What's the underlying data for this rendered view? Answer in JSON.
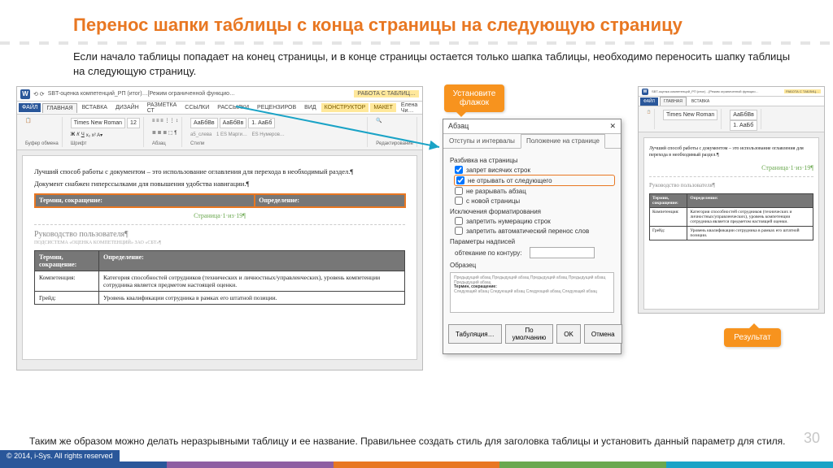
{
  "title": "Перенос шапки таблицы с конца страницы на следующую страницу",
  "intro": "Если начало таблицы попадает на конец страницы, и в конце страницы остается только шапка таблицы, необходимо переносить шапку таблицы на следующую страницу.",
  "word_left": {
    "doc_title": "SBT-оценка компетенций_РП (итог)…[Режим ограниченной функцио…",
    "context_group": "РАБОТА С ТАБЛИЦ…",
    "tabs": {
      "file": "ФАЙЛ",
      "home": "ГЛАВНАЯ",
      "insert": "ВСТАВКА",
      "design": "ДИЗАЙН",
      "layout": "РАЗМЕТКА СТ",
      "refs": "ССЫЛКИ",
      "mail": "РАССЫЛКИ",
      "review": "РЕЦЕНЗИРОВ",
      "view": "ВИД",
      "ctx1": "КОНСТРУКТОР",
      "ctx2": "МАКЕТ",
      "user": "Елена Чи…"
    },
    "font_name": "Times New Roman",
    "font_size": "12",
    "styles": [
      "АаБбВв",
      "АаБбВв",
      "1. АаБб"
    ],
    "style_labels": [
      "a5_слева",
      "1 ES Марги…",
      "ES Нумеров…"
    ],
    "groups": {
      "clipboard": "Буфер обмена",
      "font": "Шрифт",
      "para": "Абзац",
      "styles": "Стили",
      "edit": "Редактирование"
    },
    "doc": {
      "p1": "Лучший способ работы с документом – это использование оглавления для перехода в необходимый раздел.¶",
      "p2": "Документ снабжен гиперссылками для повышения удобства навигации.¶",
      "th1": "Термин, сокращение:",
      "th2": "Определение:",
      "pagenum": "Страница·1·из·19¶",
      "guide": "Руководство пользователя¶",
      "guide_sub": "ПОДСИСТЕМА «ОЦЕНКА КОМПЕТЕНЦИЙ» ЗАО «СБТ»¶",
      "row1_a": "Компетенция:",
      "row1_b": "Категория способностей сотрудников (технических и личностных/управленческих), уровень компетенции сотрудника является предметом настоящей оценки.",
      "row2_a": "Грейд:",
      "row2_b": "Уровень квалификации сотрудника в рамках его штатной позиции."
    }
  },
  "dialog": {
    "title": "Абзац",
    "close": "✕",
    "tab1": "Отступы и интервалы",
    "tab2": "Положение на странице",
    "sect1": "Разбивка на страницы",
    "opt1": "запрет висячих строк",
    "opt2": "не отрывать от следующего",
    "opt3": "не разрывать абзац",
    "opt4": "с новой страницы",
    "sect2": "Исключения форматирования",
    "opt5": "запретить нумерацию строк",
    "opt6": "запретить автоматический перенос слов",
    "sect3": "Параметры надписей",
    "sect3_label": "обтекание по контуру:",
    "preview_label": "Образец",
    "btn_tab": "Табуляция…",
    "btn_default": "По умолчанию",
    "btn_ok": "OK",
    "btn_cancel": "Отмена"
  },
  "word_right": {
    "doc_title": "SBT-оценка компетенций_РП (итог)…[Режим ограниченной функцио…",
    "context_group": "РАБОТА С ТАБЛИЦ…",
    "p1": "Лучший способ работы с документом – это использование оглавления для перехода в необходимый раздел.¶",
    "p_page": "Страница·1·из·19¶",
    "guide": "Руководство пользователя¶",
    "th1": "Термин, сокращение:",
    "th2": "Определение:",
    "row1_a": "Компетенция:",
    "row1_b": "Категория способностей сотрудников (технических и личностных/управленческих), уровень компетенции сотрудника является предметом настоящей оценки.",
    "row2_a": "Грейд:",
    "row2_b": "Уровень квалификации сотрудника в рамках его штатной позиции."
  },
  "callouts": {
    "set_flag": "Установите флажок",
    "result": "Результат"
  },
  "outro": "Таким же образом можно делать неразрывными таблицу и ее название. Правильнее создать стиль для заголовка таблицы и установить данный параметр для стиля.",
  "page_number": "30",
  "copyright": "© 2014, i-Sys. All rights reserved",
  "stripe_colors": [
    "#2a579a",
    "#8e5ea2",
    "#e87722",
    "#6aa84f",
    "#1aa3c6"
  ]
}
